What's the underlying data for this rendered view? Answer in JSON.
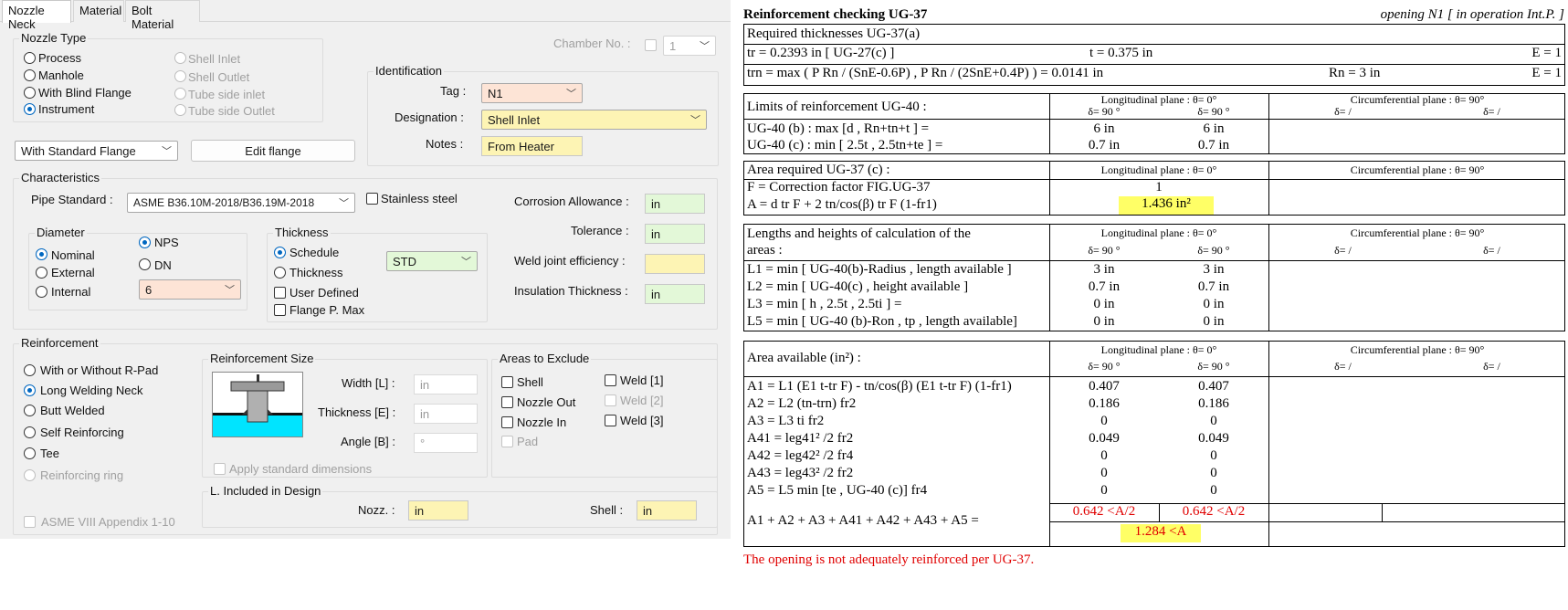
{
  "tabs": [
    "Nozzle Neck",
    "Material",
    "Bolt Material"
  ],
  "nozzle_type": {
    "title": "Nozzle Type",
    "options": [
      "Process",
      "Manhole",
      "With Blind Flange",
      "Instrument"
    ],
    "disabled_options": [
      "Shell Inlet",
      "Shell Outlet",
      "Tube side inlet",
      "Tube side Outlet"
    ],
    "selected": "Instrument"
  },
  "chamber": {
    "label": "Chamber No. :",
    "value": "1"
  },
  "identification": {
    "title": "Identification",
    "tag_label": "Tag :",
    "tag_value": "N1",
    "designation_label": "Designation :",
    "designation_value": "Shell Inlet",
    "notes_label": "Notes :",
    "notes_value": "From Heater"
  },
  "flange": {
    "combo_value": "With Standard Flange",
    "edit_label": "Edit flange"
  },
  "characteristics": {
    "title": "Characteristics",
    "pipe_standard_label": "Pipe Standard :",
    "pipe_standard_value": "ASME B36.10M-2018/B36.19M-2018",
    "stainless_label": "Stainless steel",
    "corrosion_label": "Corrosion Allowance :",
    "corrosion_unit": "in",
    "tolerance_label": "Tolerance :",
    "tolerance_unit": "in",
    "weld_label": "Weld joint efficiency :",
    "insulation_label": "Insulation Thickness :",
    "insulation_unit": "in"
  },
  "diameter": {
    "title": "Diameter",
    "options": [
      "Nominal",
      "External",
      "Internal"
    ],
    "selected": "Nominal",
    "nps_label": "NPS",
    "dn_label": "DN",
    "size_value": "6"
  },
  "thickness": {
    "title": "Thickness",
    "schedule_label": "Schedule",
    "thickness_label": "Thickness",
    "user_defined_label": "User Defined",
    "flange_pmax_label": "Flange P. Max",
    "schedule_value": "STD"
  },
  "reinforcement": {
    "title": "Reinforcement",
    "options": [
      "With or Without R-Pad",
      "Long Welding Neck",
      "Butt Welded",
      "Self Reinforcing",
      "Tee",
      "Reinforcing ring"
    ],
    "selected": "Long Welding Neck",
    "appendix_label": "ASME VIII Appendix 1-10"
  },
  "reinforcement_size": {
    "title": "Reinforcement Size",
    "width_label": "Width [L] :",
    "width_unit": "in",
    "thickness_label": "Thickness [E] :",
    "thickness_unit": "in",
    "angle_label": "Angle [B] :",
    "angle_unit": "°",
    "apply_label": "Apply standard dimensions"
  },
  "areas_exclude": {
    "title": "Areas to Exclude",
    "shell": "Shell",
    "nozzle_out": "Nozzle Out",
    "nozzle_in": "Nozzle In",
    "pad": "Pad",
    "weld1": "Weld [1]",
    "weld2": "Weld [2]",
    "weld3": "Weld [3]"
  },
  "l_included": {
    "title": "L. Included in Design",
    "nozz_label": "Nozz. :",
    "nozz_unit": "in",
    "shell_label": "Shell :",
    "shell_unit": "in"
  },
  "report": {
    "title": "Reinforcement checking UG-37",
    "opening": "opening N1 [ in operation Int.P. ]",
    "req_title": "Required thicknesses UG-37(a)",
    "tr_line": "tr = 0.2393 in   [ UG-27(c) ]",
    "t_line": "t = 0.375 in",
    "e1": "E = 1",
    "trn_line": "trn = max ( P Rn / (SnE-0.6P) , P Rn / (2SnE+0.4P) ) = 0.0141 in",
    "rn_line": "Rn = 3 in",
    "e2": "E = 1",
    "long_plane": "Longitudinal plane : θ= 0°",
    "circ_plane": "Circumferential plane : θ= 90°",
    "delta90": "δ= 90 °",
    "delta_slash": "δ= /",
    "limits_title": "Limits of reinforcement UG-40 :",
    "limits_b": "UG-40 (b) : max [d , Rn+tn+t ] =",
    "limits_c": "UG-40 (c) : min [ 2.5t , 2.5tn+te ] =",
    "limits_b_vals": [
      "6 in",
      "6 in"
    ],
    "limits_c_vals": [
      "0.7 in",
      "0.7 in"
    ],
    "area_req_title": "Area required UG-37 (c) :",
    "f_line": "F = Correction factor FIG.UG-37",
    "f_val": "1",
    "a_line": "A = d tr F + 2 tn/cos(β) tr F (1-fr1)",
    "a_val": "1.436 in²",
    "lengths_title1": "Lengths and heights of calculation of the",
    "lengths_title2": "areas :",
    "l_rows": [
      "L1 = min [ UG-40(b)-Radius , length available ]",
      "L2 = min [ UG-40(c) , height available ]",
      "L3 = min [ h , 2.5t , 2.5ti ] =",
      "L5 = min [ UG-40 (b)-Ron , tp , length available]"
    ],
    "l_vals": [
      [
        "3 in",
        "3 in"
      ],
      [
        "0.7 in",
        "0.7 in"
      ],
      [
        "0 in",
        "0 in"
      ],
      [
        "0 in",
        "0 in"
      ]
    ],
    "avail_title": "Area available (in²) :",
    "a_rows": [
      "A1 = L1 (E1 t-tr F) - tn/cos(β) (E1 t-tr F) (1-fr1)",
      "A2 = L2 (tn-trn) fr2",
      "A3 = L3 ti fr2",
      "A41 = leg41² /2 fr2",
      "A42 = leg42² /2 fr4",
      "A43 = leg43² /2 fr2",
      "A5 = L5 min [te , UG-40 (c)] fr4"
    ],
    "a_vals": [
      [
        "0.407",
        "0.407"
      ],
      [
        "0.186",
        "0.186"
      ],
      [
        "0",
        "0"
      ],
      [
        "0.049",
        "0.049"
      ],
      [
        "0",
        "0"
      ],
      [
        "0",
        "0"
      ],
      [
        "0",
        "0"
      ]
    ],
    "sum_line": "A1 + A2 + A3 + A41 + A42 + A43 + A5 =",
    "half_vals": [
      "0.642 <A/2",
      "0.642 <A/2"
    ],
    "sum_val": "1.284 <A",
    "verdict": "The opening is not adequately reinforced per UG-37."
  },
  "colors": {
    "highlight": "#ffff66",
    "fail": "#e00000",
    "selected": "#0067c0"
  }
}
